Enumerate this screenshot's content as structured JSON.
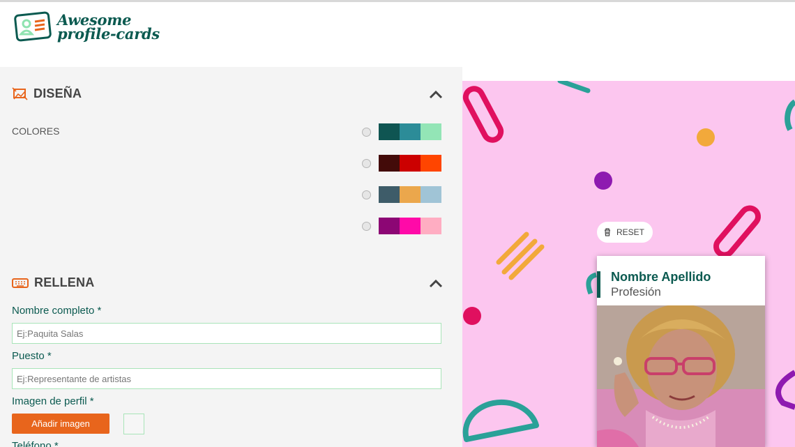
{
  "app": {
    "logo_line1": "Awesome",
    "logo_line2": "profile-cards"
  },
  "design": {
    "title": "DISEÑA",
    "colors_label": "COLORES",
    "palettes": [
      [
        "#0f5552",
        "#2c8c98",
        "#93e5b6"
      ],
      [
        "#430b09",
        "#cc0000",
        "#ff4500"
      ],
      [
        "#3e5c69",
        "#eba74c",
        "#a0c4d6"
      ],
      [
        "#8c0674",
        "#ff0aa8",
        "#ffadc2"
      ]
    ]
  },
  "fill": {
    "title": "RELLENA",
    "name_label": "Nombre completo *",
    "name_placeholder": "Ej:Paquita Salas",
    "job_label": "Puesto *",
    "job_placeholder": "Ej:Representante de artistas",
    "image_label": "Imagen de perfil *",
    "image_button": "Añadir imagen",
    "phone_label": "Teléfono *"
  },
  "preview": {
    "reset_label": "RESET",
    "card_name": "Nombre Apellido",
    "card_job": "Profesión"
  },
  "colors": {
    "accent": "#0b5a50",
    "orange": "#e8651c",
    "canvas_pink": "#fcc6ef"
  }
}
